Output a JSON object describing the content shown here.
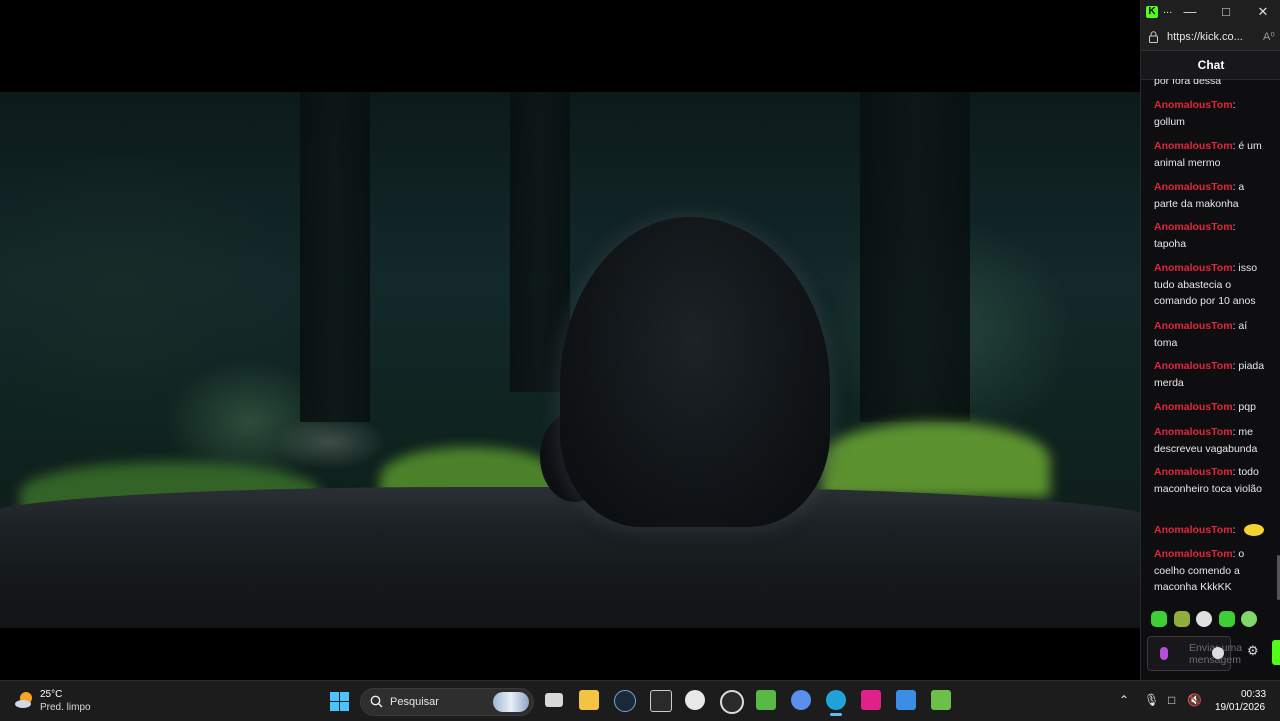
{
  "browser": {
    "title_ellipsis": "...",
    "url": "https://kick.co...",
    "read_aloud_label": "A⁰"
  },
  "chat": {
    "title": "Chat",
    "partial_top_text": "por fora dessa",
    "messages": [
      {
        "user": "AnomalousTom",
        "text": "gollum"
      },
      {
        "user": "AnomalousTom",
        "text": "é um animal mermo"
      },
      {
        "user": "AnomalousTom",
        "text": "a parte da makonha"
      },
      {
        "user": "AnomalousTom",
        "text": "tapoha"
      },
      {
        "user": "AnomalousTom",
        "text": "isso tudo abastecia o comando por 10 anos"
      },
      {
        "user": "AnomalousTom",
        "text": "aí toma"
      },
      {
        "user": "AnomalousTom",
        "text": "piada merda"
      },
      {
        "user": "AnomalousTom",
        "text": "pqp"
      },
      {
        "user": "AnomalousTom",
        "text": "me descreveu vagabunda"
      },
      {
        "user": "AnomalousTom",
        "text": "todo maconheiro toca violão"
      },
      {
        "user": "AnomalousTom",
        "text": ""
      },
      {
        "user": "AnomalousTom",
        "text": "o coelho comendo a maconha KkkKK"
      }
    ],
    "input_placeholder": "Enviar uma mensagem",
    "user_color": "#e0263f",
    "accent_color": "#53fc18"
  },
  "taskbar": {
    "weather_temp": "25°C",
    "weather_desc": "Pred. limpo",
    "search_placeholder": "Pesquisar",
    "clock_time": "00:33",
    "clock_date": "19/01/2026",
    "apps": [
      "task-view-icon",
      "file-explorer-icon",
      "steam-icon",
      "epic-games-icon",
      "github-icon",
      "chrome-icon",
      "xbox-icon",
      "discord-icon",
      "edge-icon",
      "paint-icon",
      "photos-icon",
      "bluestacks-icon"
    ]
  }
}
